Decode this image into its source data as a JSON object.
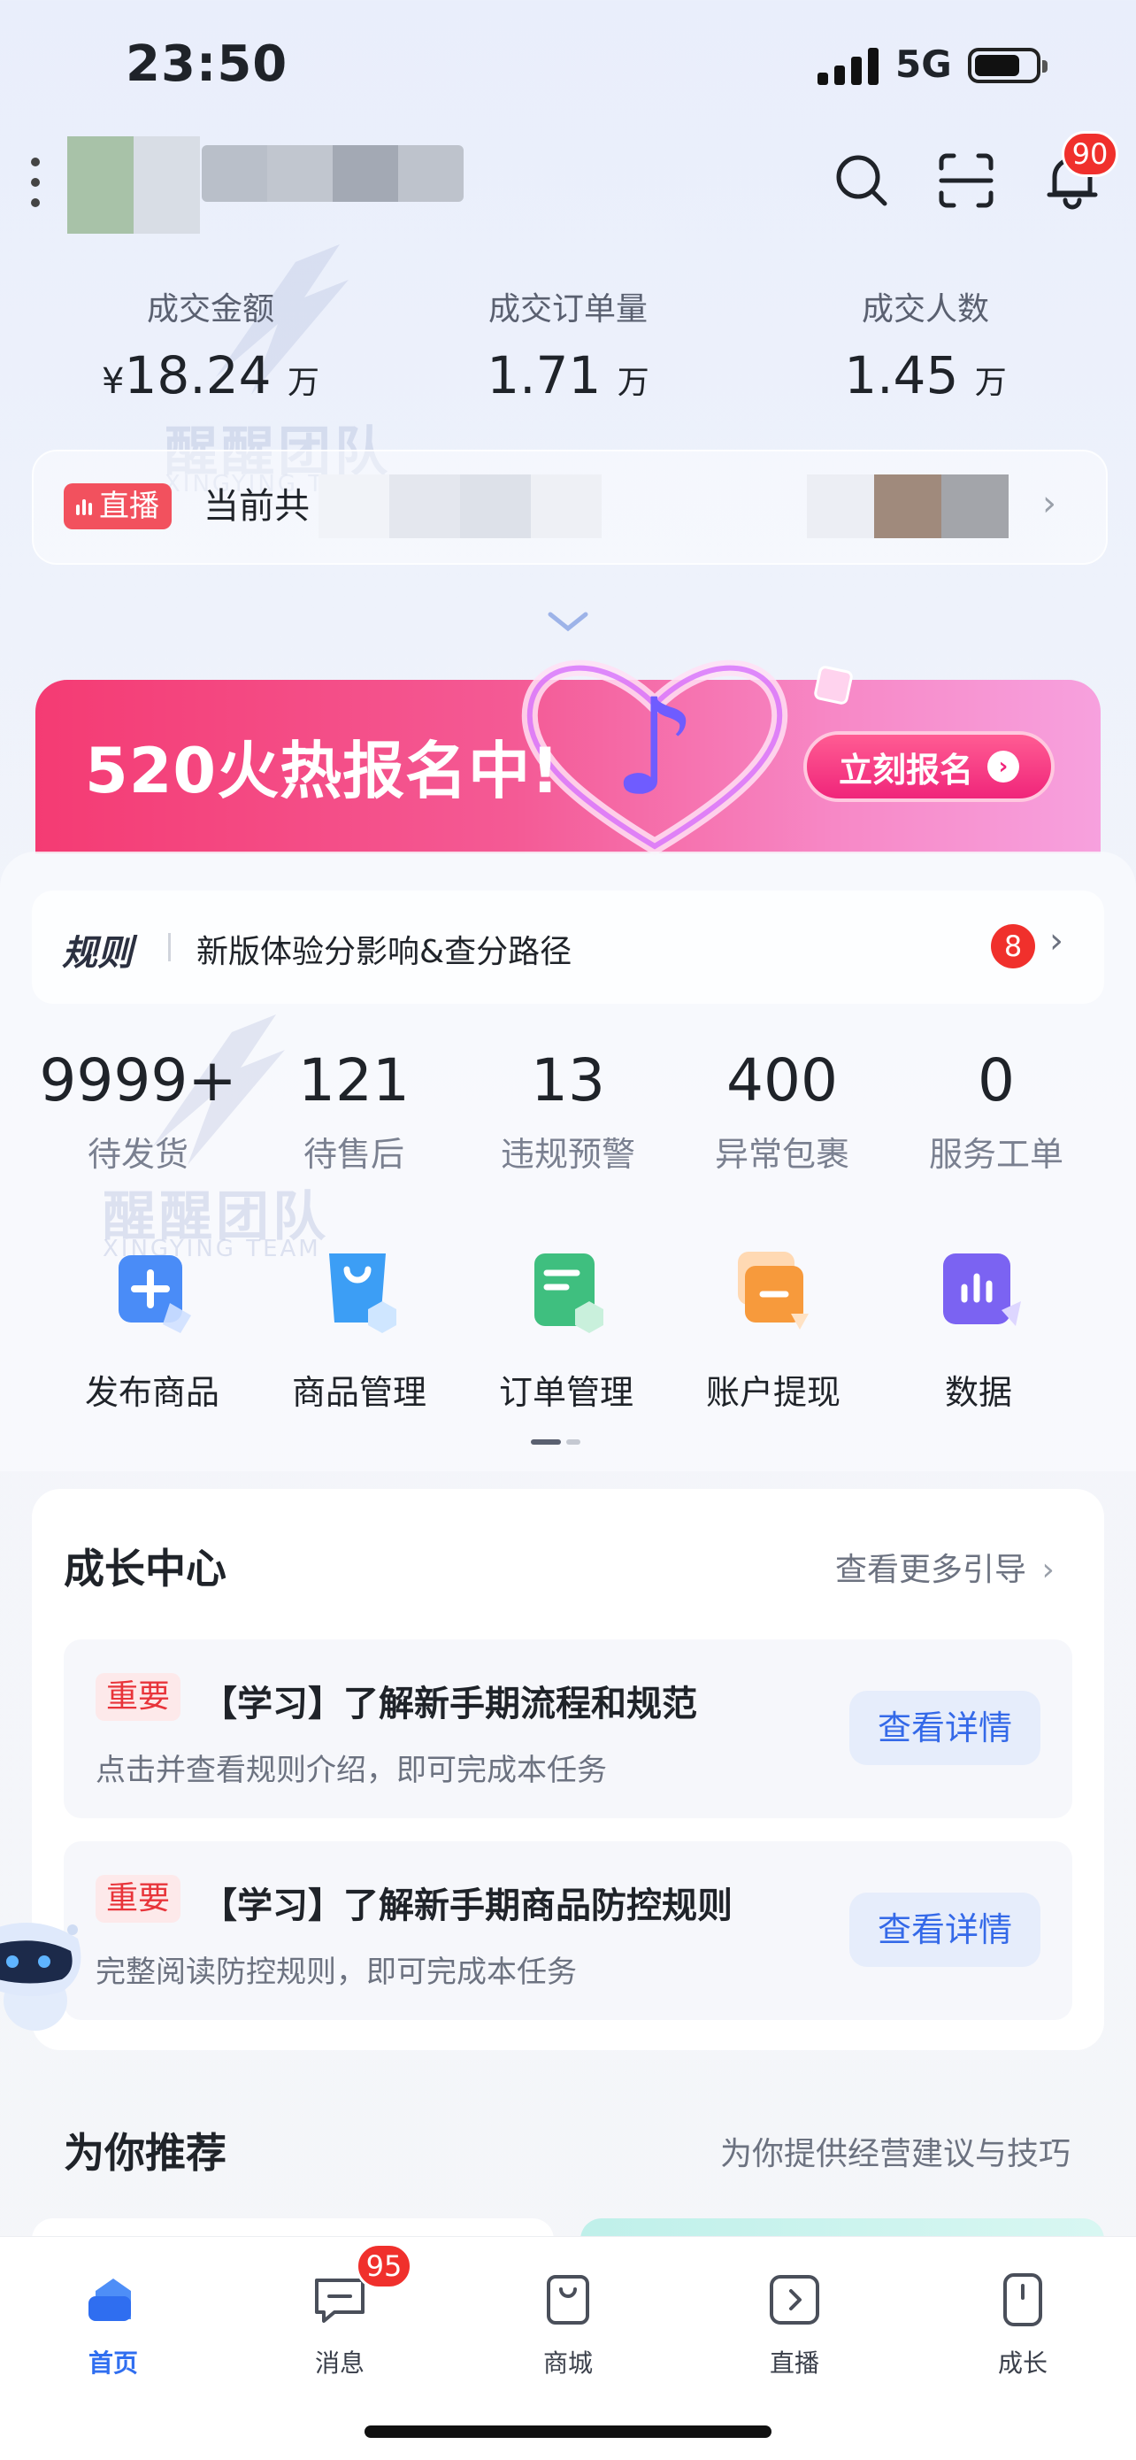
{
  "status_bar": {
    "time": "23:50",
    "network": "5G",
    "battery_level": 0.7
  },
  "header": {
    "notification_count": "90"
  },
  "stats": [
    {
      "label": "成交金额",
      "currency": "¥",
      "value": "18.24",
      "unit": "万"
    },
    {
      "label": "成交订单量",
      "currency": "",
      "value": "1.71",
      "unit": "万"
    },
    {
      "label": "成交人数",
      "currency": "",
      "value": "1.45",
      "unit": "万"
    }
  ],
  "live": {
    "tag": "直播",
    "text": "当前共"
  },
  "watermark": {
    "name": "醒醒团队",
    "sub": "XINGYING TEAM"
  },
  "banner": {
    "title": "520火热报名中!",
    "button": "立刻报名"
  },
  "rules": {
    "title": "规则",
    "text": "新版体验分影响&查分路径",
    "badge": "8"
  },
  "metrics": [
    {
      "value": "9999+",
      "label": "待发货"
    },
    {
      "value": "121",
      "label": "待售后"
    },
    {
      "value": "13",
      "label": "违规预警"
    },
    {
      "value": "400",
      "label": "异常包裹"
    },
    {
      "value": "0",
      "label": "服务工单"
    }
  ],
  "tools": [
    {
      "label": "发布商品",
      "icon": "publish-product-icon",
      "color": "#4a8cf7"
    },
    {
      "label": "商品管理",
      "icon": "product-manage-icon",
      "color": "#3c9ef5"
    },
    {
      "label": "订单管理",
      "icon": "order-manage-icon",
      "color": "#3fbf7f"
    },
    {
      "label": "账户提现",
      "icon": "withdraw-icon",
      "color": "#f79a3c"
    },
    {
      "label": "数据",
      "icon": "data-icon",
      "color": "#7b63f2"
    }
  ],
  "growth": {
    "title": "成长中心",
    "more": "查看更多引导",
    "tasks": [
      {
        "tag": "重要",
        "title": "【学习】了解新手期流程和规范",
        "desc": "点击并查看规则介绍，即可完成本任务",
        "button": "查看详情"
      },
      {
        "tag": "重要",
        "title": "【学习】了解新手期商品防控规则",
        "desc": "完整阅读防控规则，即可完成本任务",
        "button": "查看详情"
      }
    ]
  },
  "recommend": {
    "title": "为你推荐",
    "subtitle": "为你提供经营建议与技巧"
  },
  "tabbar": {
    "items": [
      {
        "label": "首页",
        "active": true
      },
      {
        "label": "消息",
        "badge": "95"
      },
      {
        "label": "商城"
      },
      {
        "label": "直播"
      },
      {
        "label": "成长"
      }
    ]
  },
  "colors": {
    "accent": "#3469e8",
    "alert": "#f0302c",
    "live": "#f2515e"
  }
}
